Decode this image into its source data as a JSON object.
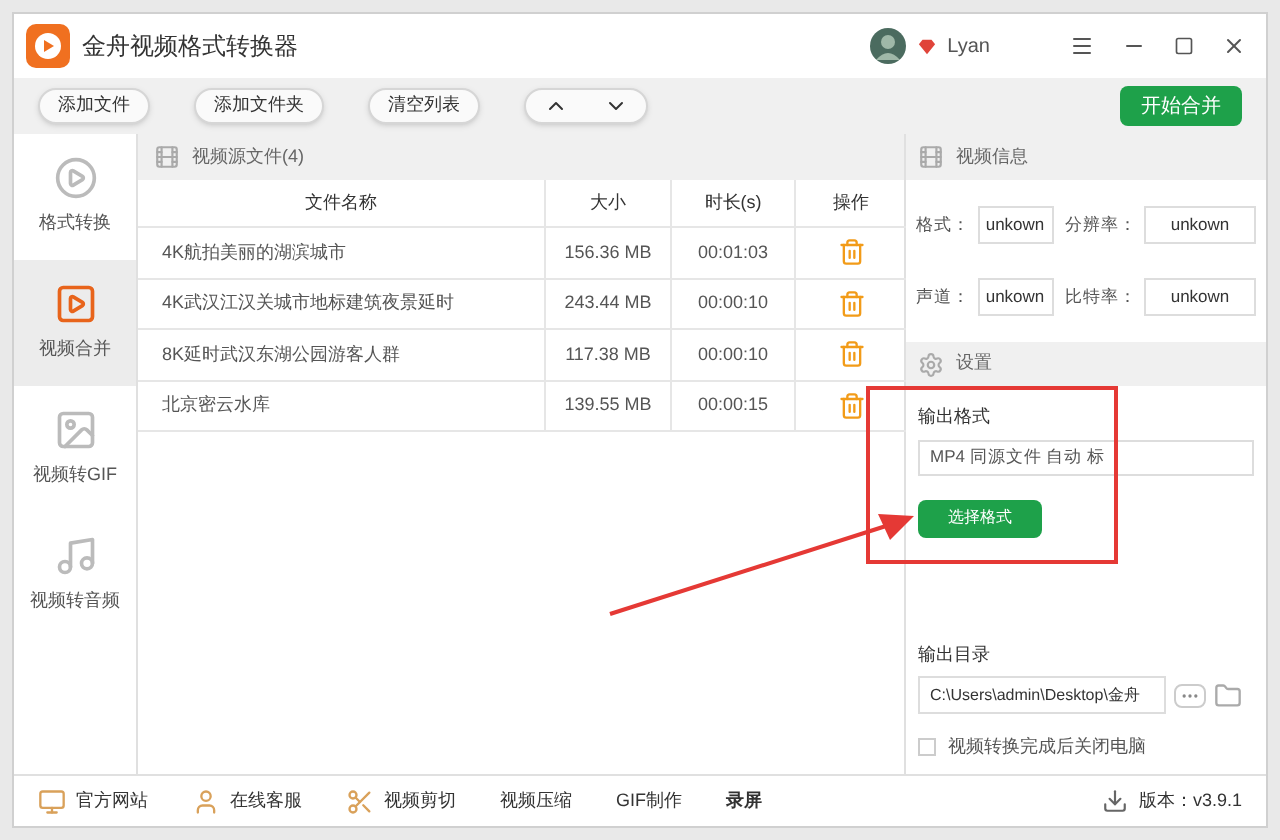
{
  "window": {
    "title": "金舟视频格式转换器",
    "user": "Lyan"
  },
  "toolbar": {
    "buttons": [
      "添加文件",
      "添加文件夹",
      "清空列表"
    ],
    "primary": "开始合并"
  },
  "sidebar": {
    "items": [
      {
        "label": "格式转换",
        "kind": "convert",
        "selected": false
      },
      {
        "label": "视频合并",
        "kind": "merge",
        "selected": true
      },
      {
        "label": "视频转GIF",
        "kind": "gif",
        "selected": false
      },
      {
        "label": "视频转音频",
        "kind": "audio",
        "selected": false
      }
    ]
  },
  "file_list": {
    "title": "视频源文件(4)",
    "columns": [
      "文件名称",
      "大小",
      "时长(s)",
      "操作"
    ],
    "rows": [
      {
        "name": "4K航拍美丽的湖滨城市",
        "size": "156.36 MB",
        "duration": "00:01:03"
      },
      {
        "name": "4K武汉江汉关城市地标建筑夜景延时",
        "size": "243.44 MB",
        "duration": "00:00:10"
      },
      {
        "name": "8K延时武汉东湖公园游客人群",
        "size": "117.38 MB",
        "duration": "00:00:10"
      },
      {
        "name": "北京密云水库",
        "size": "139.55 MB",
        "duration": "00:00:15"
      }
    ]
  },
  "video_info": {
    "title": "视频信息",
    "fields": [
      {
        "label": "格式：",
        "value": "unkown"
      },
      {
        "label": "分辨率：",
        "value": "unkown"
      },
      {
        "label": "声道：",
        "value": "unkown"
      },
      {
        "label": "比特率：",
        "value": "unkown"
      }
    ]
  },
  "settings": {
    "title": "设置",
    "format_label": "输出格式",
    "format_value": "MP4 同源文件 自动 标",
    "format_button": "选择格式",
    "dir_label": "输出目录",
    "dir_value": "C:\\Users\\admin\\Desktop\\金舟",
    "shutdown_label": "视频转换完成后关闭电脑",
    "shutdown_checked": false
  },
  "status_bar": {
    "items": [
      {
        "label": "官方网站",
        "kind": "monitor"
      },
      {
        "label": "在线客服",
        "kind": "person"
      },
      {
        "label": "视频剪切",
        "kind": "scissors"
      },
      {
        "label": "视频压缩",
        "kind": "plain"
      },
      {
        "label": "GIF制作",
        "kind": "plain"
      },
      {
        "label": "录屏",
        "kind": "bold"
      }
    ],
    "version": "版本：v3.9.1"
  }
}
